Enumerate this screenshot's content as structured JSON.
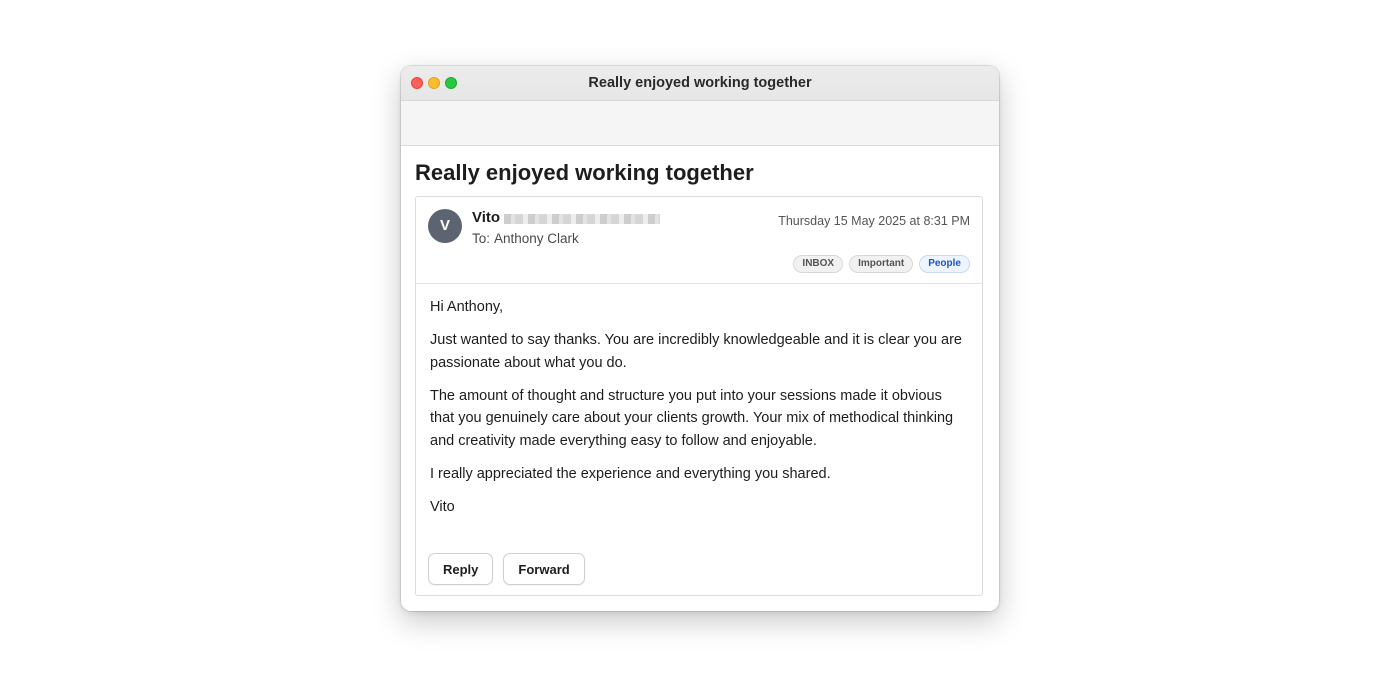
{
  "window": {
    "title": "Really enjoyed working together"
  },
  "email": {
    "subject": "Really enjoyed working together",
    "sender": {
      "initial": "V",
      "name": "Vito"
    },
    "recipient": {
      "prefix": "To:",
      "name": "Anthony Clark"
    },
    "date": "Thursday 15 May 2025 at 8:31 PM",
    "tags": [
      {
        "label": "INBOX",
        "color": "#555555"
      },
      {
        "label": "Important",
        "color": "#555555"
      },
      {
        "label": "People",
        "color": "#1a57c4"
      }
    ],
    "body": [
      "Hi Anthony,",
      "Just wanted to say thanks. You are incredibly knowledgeable and it is clear you are passionate about what you do.",
      "The amount of thought and structure you put into your sessions made it obvious that you genuinely care about your clients growth. Your mix of methodical thinking and creativity made everything easy to follow and enjoyable.",
      "I really appreciated the experience and everything you shared.",
      "Vito"
    ]
  },
  "actions": {
    "reply_label": "Reply",
    "forward_label": "Forward"
  },
  "colors": {
    "close": "#ff5f57",
    "minimize": "#febc2e",
    "zoom": "#28c840",
    "avatar": "#5b6470"
  }
}
